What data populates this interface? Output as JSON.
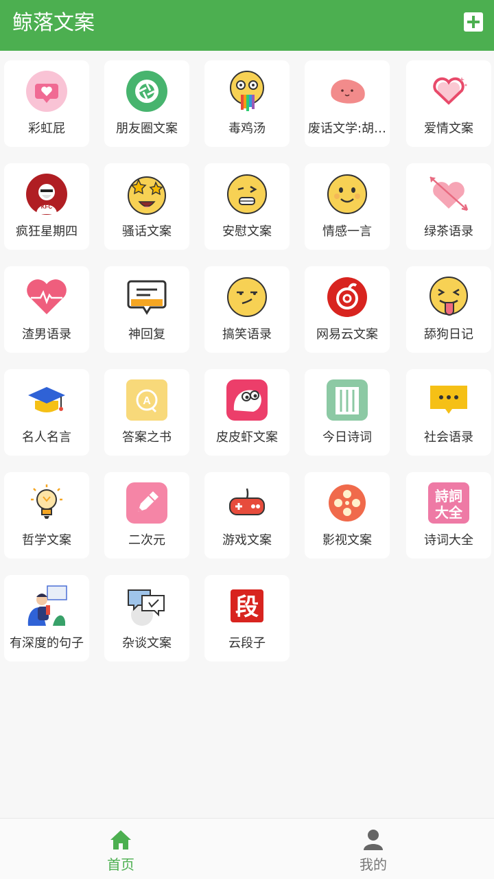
{
  "app": {
    "title": "鲸落文案"
  },
  "categories": [
    {
      "label": "彩虹屁",
      "icon": "pink-heart-bubble-icon"
    },
    {
      "label": "朋友圈文案",
      "icon": "camera-shutter-icon"
    },
    {
      "label": "毒鸡汤",
      "icon": "rainbow-drool-emoji-icon"
    },
    {
      "label": "废话文学:胡…",
      "icon": "pink-blob-icon"
    },
    {
      "label": "爱情文案",
      "icon": "sparkle-heart-icon"
    },
    {
      "label": "疯狂星期四",
      "icon": "kfc-logo-icon"
    },
    {
      "label": "骚话文案",
      "icon": "star-eyes-emoji-icon"
    },
    {
      "label": "安慰文案",
      "icon": "grimace-emoji-icon"
    },
    {
      "label": "情感一言",
      "icon": "smile-emoji-icon"
    },
    {
      "label": "绿茶语录",
      "icon": "arrow-heart-icon"
    },
    {
      "label": "渣男语录",
      "icon": "heartbeat-heart-icon"
    },
    {
      "label": "神回复",
      "icon": "chat-bubble-icon"
    },
    {
      "label": "搞笑语录",
      "icon": "smirk-emoji-icon"
    },
    {
      "label": "网易云文案",
      "icon": "netease-music-icon"
    },
    {
      "label": "舔狗日记",
      "icon": "tongue-emoji-icon"
    },
    {
      "label": "名人名言",
      "icon": "graduation-cap-icon"
    },
    {
      "label": "答案之书",
      "icon": "answer-book-icon"
    },
    {
      "label": "皮皮虾文案",
      "icon": "pipixia-app-icon"
    },
    {
      "label": "今日诗词",
      "icon": "poetry-scroll-icon"
    },
    {
      "label": "社会语录",
      "icon": "ellipsis-bubble-icon"
    },
    {
      "label": "哲学文案",
      "icon": "lightbulb-icon"
    },
    {
      "label": "二次元",
      "icon": "pencil-icon"
    },
    {
      "label": "游戏文案",
      "icon": "gamepad-icon"
    },
    {
      "label": "影视文案",
      "icon": "film-reel-icon"
    },
    {
      "label": "诗词大全",
      "icon": "poetry-collection-icon"
    },
    {
      "label": "有深度的句子",
      "icon": "thinker-illustration-icon"
    },
    {
      "label": "杂谈文案",
      "icon": "chat-bubbles-icon"
    },
    {
      "label": "云段子",
      "icon": "duan-character-icon"
    }
  ],
  "poetry_collection_icon_text": "詩詞大全",
  "duan_icon_text": "段",
  "answer_book_icon_text": "A",
  "kfc_text": "KFC",
  "nav": {
    "home": "首页",
    "mine": "我的"
  },
  "colors": {
    "primary": "#4caf50",
    "card": "#ffffff",
    "background": "#f7f7f7"
  }
}
